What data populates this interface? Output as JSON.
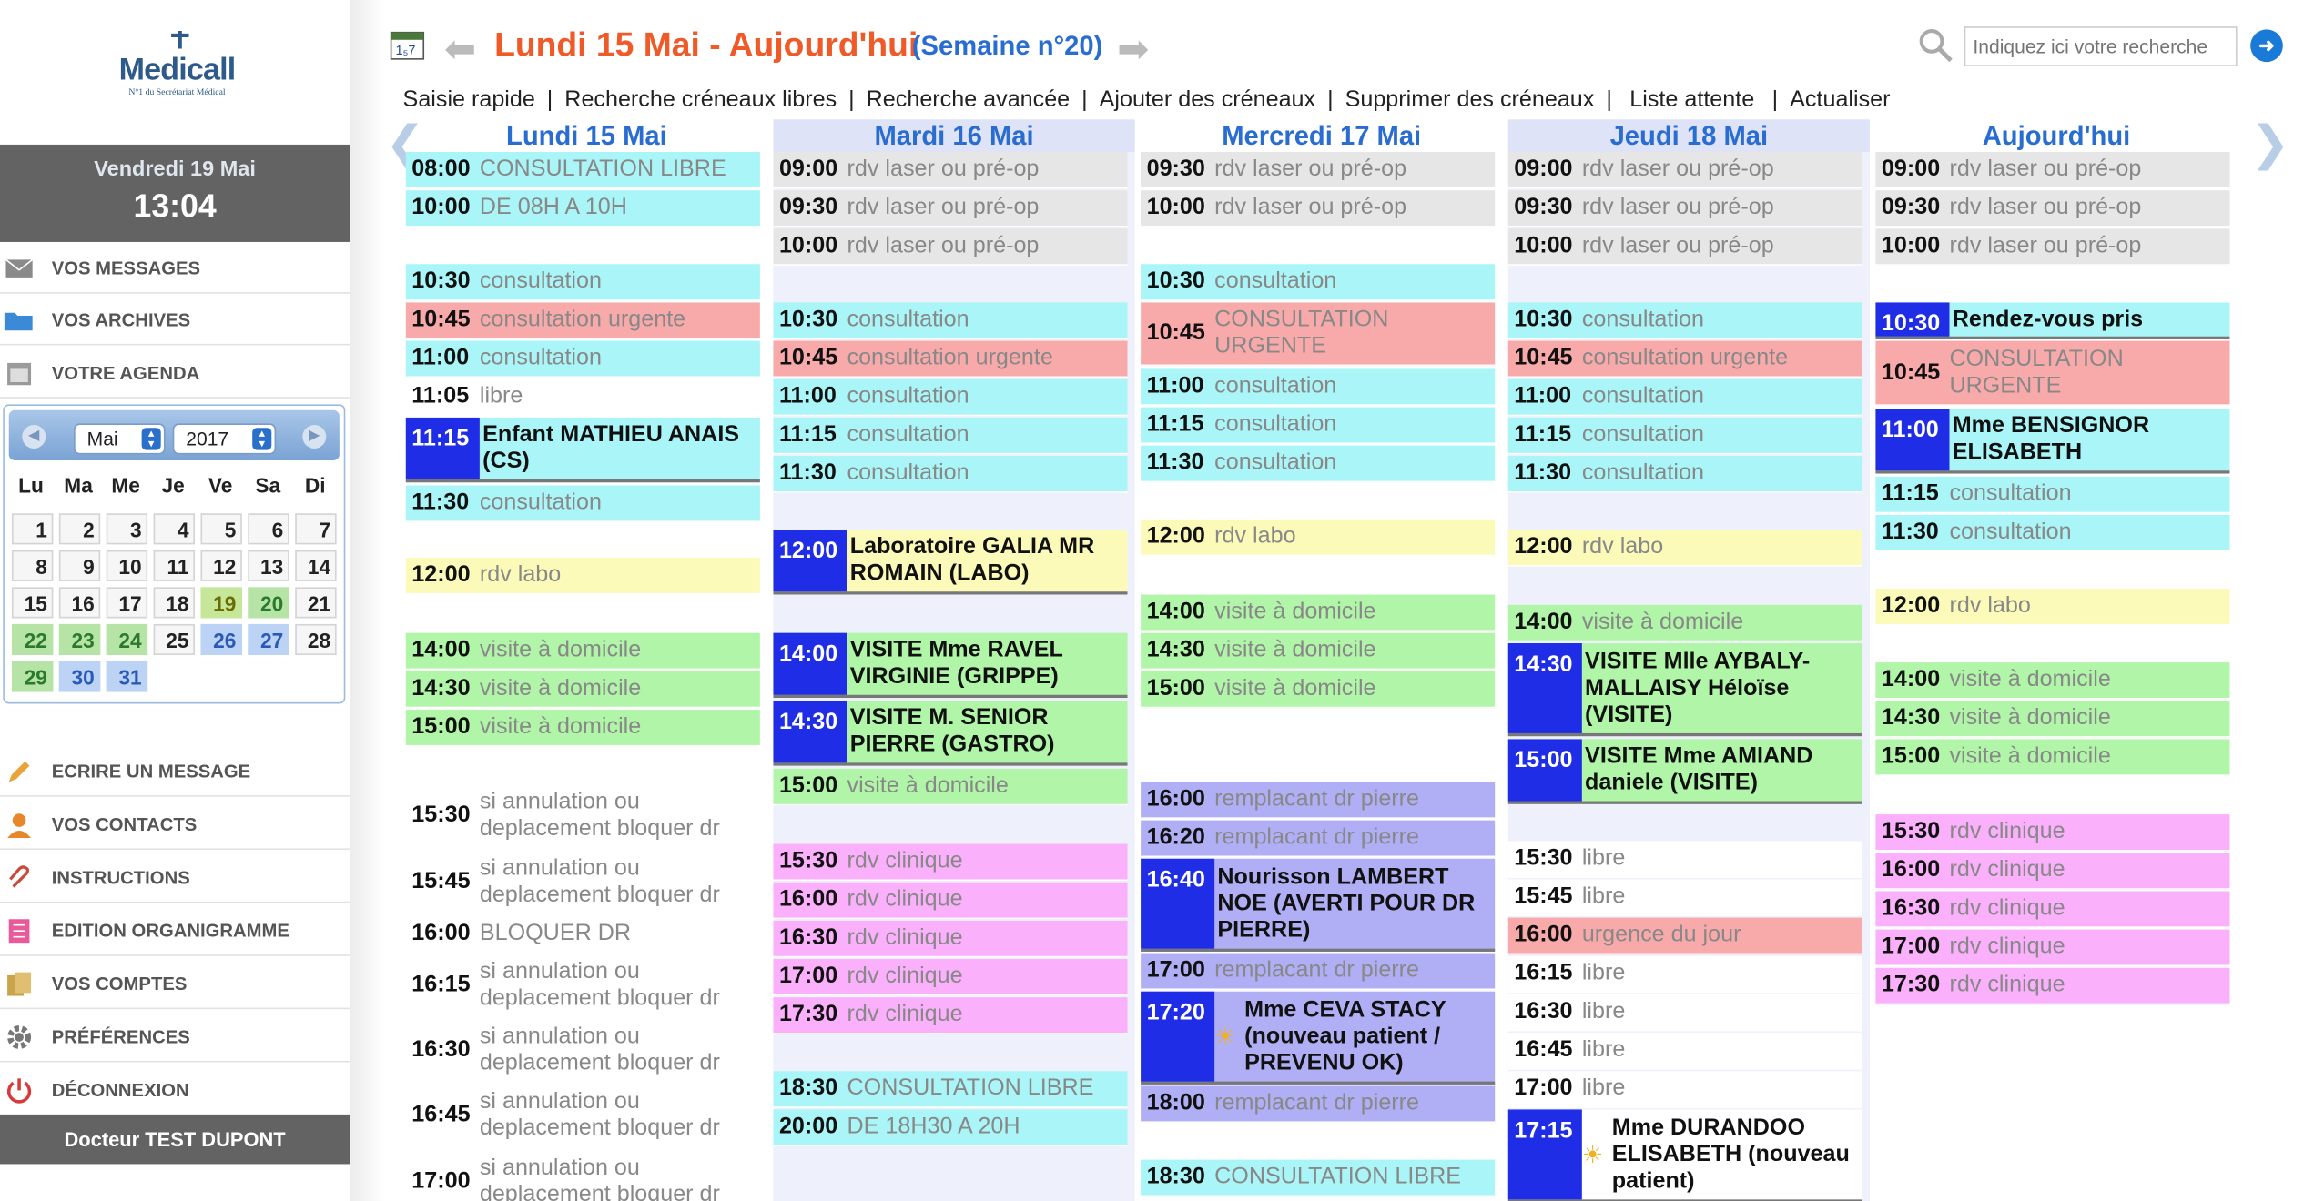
{
  "brand": {
    "name": "Medicall",
    "tagline": "N°1 du Secrétariat Médical"
  },
  "sidebar": {
    "date": "Vendredi 19 Mai",
    "time": "13:04",
    "items": [
      "VOS MESSAGES",
      "VOS ARCHIVES",
      "VOTRE AGENDA"
    ],
    "items2": [
      "ECRIRE UN MESSAGE",
      "VOS CONTACTS",
      "INSTRUCTIONS",
      "EDITION ORGANIGRAMME",
      "VOS COMPTES",
      "PRÉFÉRENCES",
      "DÉCONNEXION"
    ],
    "doctor": "Docteur TEST DUPONT"
  },
  "calendar": {
    "month": "Mai",
    "year": "2017",
    "dow": [
      "Lu",
      "Ma",
      "Me",
      "Je",
      "Ve",
      "Sa",
      "Di"
    ],
    "days": [
      "1",
      "2",
      "3",
      "4",
      "5",
      "6",
      "7",
      "8",
      "9",
      "10",
      "11",
      "12",
      "13",
      "14",
      "15",
      "16",
      "17",
      "18",
      "19",
      "20",
      "21",
      "22",
      "23",
      "24",
      "25",
      "26",
      "27",
      "28",
      "29",
      "30",
      "31"
    ]
  },
  "header": {
    "title": "Lundi 15 Mai - Aujourd'hui",
    "week": "(Semaine n°20)",
    "search_placeholder": "Indiquez ici votre recherche"
  },
  "toolbar": [
    "Saisie rapide",
    "Recherche créneaux libres",
    "Recherche avancée",
    "Ajouter des créneaux",
    "Supprimer des créneaux",
    "Liste attente",
    "Actualiser"
  ],
  "days": [
    {
      "label": "Lundi 15 Mai",
      "events": [
        {
          "t": "08:00",
          "x": "CONSULTATION LIBRE"
        },
        {
          "t": "10:00",
          "x": "DE 08H A 10H"
        },
        {
          "t": "10:30",
          "x": "consultation"
        },
        {
          "t": "10:45",
          "x": "consultation urgente"
        },
        {
          "t": "11:00",
          "x": "consultation"
        },
        {
          "t": "11:05",
          "x": "libre"
        },
        {
          "t": "11:15",
          "x": "Enfant MATHIEU ANAIS (CS)"
        },
        {
          "t": "11:30",
          "x": "consultation"
        },
        {
          "t": "12:00",
          "x": "rdv labo"
        },
        {
          "t": "14:00",
          "x": "visite à domicile"
        },
        {
          "t": "14:30",
          "x": "visite à domicile"
        },
        {
          "t": "15:00",
          "x": "visite à domicile"
        },
        {
          "t": "15:30",
          "x": "si annulation ou deplacement bloquer dr"
        },
        {
          "t": "15:45",
          "x": "si annulation ou deplacement bloquer dr"
        },
        {
          "t": "16:00",
          "x": "BLOQUER DR"
        },
        {
          "t": "16:15",
          "x": "si annulation ou deplacement bloquer dr"
        },
        {
          "t": "16:30",
          "x": "si annulation ou deplacement bloquer dr"
        },
        {
          "t": "16:45",
          "x": "si annulation ou deplacement bloquer dr"
        },
        {
          "t": "17:00",
          "x": "si annulation ou deplacement bloquer dr"
        }
      ]
    },
    {
      "label": "Mardi 16 Mai",
      "events": [
        {
          "t": "09:00",
          "x": "rdv laser ou pré-op"
        },
        {
          "t": "09:30",
          "x": "rdv laser ou pré-op"
        },
        {
          "t": "10:00",
          "x": "rdv laser ou pré-op"
        },
        {
          "t": "10:30",
          "x": "consultation"
        },
        {
          "t": "10:45",
          "x": "consultation urgente"
        },
        {
          "t": "11:00",
          "x": "consultation"
        },
        {
          "t": "11:15",
          "x": "consultation"
        },
        {
          "t": "11:30",
          "x": "consultation"
        },
        {
          "t": "12:00",
          "x": "Laboratoire GALIA MR ROMAIN (LABO)"
        },
        {
          "t": "14:00",
          "x": "VISITE Mme RAVEL VIRGINIE (GRIPPE)"
        },
        {
          "t": "14:30",
          "x": "VISITE M. SENIOR PIERRE (GASTRO)"
        },
        {
          "t": "15:00",
          "x": "visite à domicile"
        },
        {
          "t": "15:30",
          "x": "rdv clinique"
        },
        {
          "t": "16:00",
          "x": "rdv clinique"
        },
        {
          "t": "16:30",
          "x": "rdv clinique"
        },
        {
          "t": "17:00",
          "x": "rdv clinique"
        },
        {
          "t": "17:30",
          "x": "rdv clinique"
        },
        {
          "t": "18:30",
          "x": "CONSULTATION LIBRE"
        },
        {
          "t": "20:00",
          "x": "DE 18H30 A 20H"
        }
      ]
    },
    {
      "label": "Mercredi 17 Mai",
      "events": [
        {
          "t": "09:30",
          "x": "rdv laser ou pré-op"
        },
        {
          "t": "10:00",
          "x": "rdv laser ou pré-op"
        },
        {
          "t": "10:30",
          "x": "consultation"
        },
        {
          "t": "10:45",
          "x": "CONSULTATION URGENTE"
        },
        {
          "t": "11:00",
          "x": "consultation"
        },
        {
          "t": "11:15",
          "x": "consultation"
        },
        {
          "t": "11:30",
          "x": "consultation"
        },
        {
          "t": "12:00",
          "x": "rdv labo"
        },
        {
          "t": "14:00",
          "x": "visite à domicile"
        },
        {
          "t": "14:30",
          "x": "visite à domicile"
        },
        {
          "t": "15:00",
          "x": "visite à domicile"
        },
        {
          "t": "16:00",
          "x": "remplacant dr pierre"
        },
        {
          "t": "16:20",
          "x": "remplacant dr pierre"
        },
        {
          "t": "16:40",
          "x": "Nourisson LAMBERT NOE (AVERTI POUR DR PIERRE)"
        },
        {
          "t": "17:00",
          "x": "remplacant dr pierre"
        },
        {
          "t": "17:20",
          "x": "Mme CEVA STACY (nouveau patient / PREVENU OK)"
        },
        {
          "t": "18:00",
          "x": "remplacant dr pierre"
        },
        {
          "t": "18:30",
          "x": "CONSULTATION LIBRE"
        }
      ]
    },
    {
      "label": "Jeudi 18 Mai",
      "events": [
        {
          "t": "09:00",
          "x": "rdv laser ou pré-op"
        },
        {
          "t": "09:30",
          "x": "rdv laser ou pré-op"
        },
        {
          "t": "10:00",
          "x": "rdv laser ou pré-op"
        },
        {
          "t": "10:30",
          "x": "consultation"
        },
        {
          "t": "10:45",
          "x": "consultation urgente"
        },
        {
          "t": "11:00",
          "x": "consultation"
        },
        {
          "t": "11:15",
          "x": "consultation"
        },
        {
          "t": "11:30",
          "x": "consultation"
        },
        {
          "t": "12:00",
          "x": "rdv labo"
        },
        {
          "t": "14:00",
          "x": "visite à domicile"
        },
        {
          "t": "14:30",
          "x": "VISITE Mlle AYBALY-MALLAISY Héloïse (VISITE)"
        },
        {
          "t": "15:00",
          "x": "VISITE Mme AMIAND daniele (VISITE)"
        },
        {
          "t": "15:30",
          "x": "libre"
        },
        {
          "t": "15:45",
          "x": "libre"
        },
        {
          "t": "16:00",
          "x": "urgence du jour"
        },
        {
          "t": "16:15",
          "x": "libre"
        },
        {
          "t": "16:30",
          "x": "libre"
        },
        {
          "t": "16:45",
          "x": "libre"
        },
        {
          "t": "17:00",
          "x": "libre"
        },
        {
          "t": "17:15",
          "x": "Mme DURANDOO ELISABETH (nouveau patient)"
        }
      ]
    },
    {
      "label": "Aujourd'hui",
      "events": [
        {
          "t": "09:00",
          "x": "rdv laser ou pré-op"
        },
        {
          "t": "09:30",
          "x": "rdv laser ou pré-op"
        },
        {
          "t": "10:00",
          "x": "rdv laser ou pré-op"
        },
        {
          "t": "10:30",
          "x": "Rendez-vous pris"
        },
        {
          "t": "10:45",
          "x": "CONSULTATION URGENTE"
        },
        {
          "t": "11:00",
          "x": "Mme BENSIGNOR ELISABETH"
        },
        {
          "t": "11:15",
          "x": "consultation"
        },
        {
          "t": "11:30",
          "x": "consultation"
        },
        {
          "t": "12:00",
          "x": "rdv labo"
        },
        {
          "t": "14:00",
          "x": "visite à domicile"
        },
        {
          "t": "14:30",
          "x": "visite à domicile"
        },
        {
          "t": "15:00",
          "x": "visite à domicile"
        },
        {
          "t": "15:30",
          "x": "rdv clinique"
        },
        {
          "t": "16:00",
          "x": "rdv clinique"
        },
        {
          "t": "16:30",
          "x": "rdv clinique"
        },
        {
          "t": "17:00",
          "x": "rdv clinique"
        },
        {
          "t": "17:30",
          "x": "rdv clinique"
        }
      ]
    }
  ]
}
